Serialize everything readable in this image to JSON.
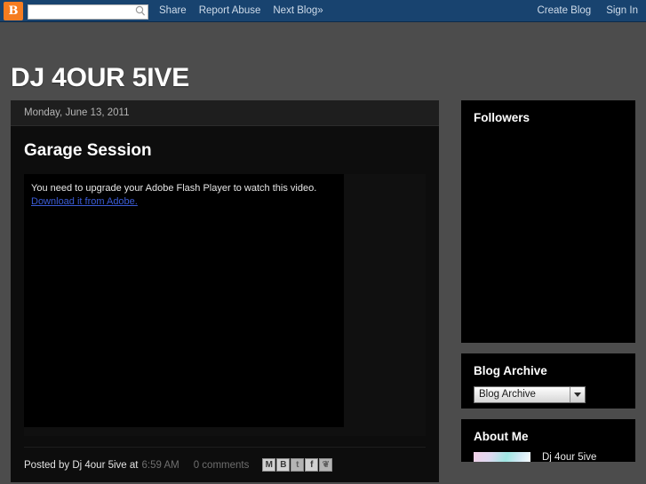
{
  "navbar": {
    "logo_text": "B",
    "logo_icon": "blogger-logo-icon",
    "search_value": "",
    "search_placeholder": "",
    "search_icon": "search-icon",
    "links": [
      {
        "label": "Share"
      },
      {
        "label": "Report Abuse"
      },
      {
        "label": "Next Blog»"
      }
    ],
    "right_links": [
      {
        "label": "Create Blog"
      },
      {
        "label": "Sign In"
      }
    ],
    "background_color": "#18436f",
    "logo_color": "#f57c20"
  },
  "header": {
    "title": "DJ 4OUR 5IVE",
    "background_color": "#4c4c4c",
    "title_color": "#ffffff"
  },
  "main": {
    "date_header": "Monday, June 13, 2011",
    "post": {
      "title": "Garage Session",
      "flash_message": "You need to upgrade your Adobe Flash Player to watch this video.",
      "flash_link_label": "Download it from Adobe.",
      "flash_link_color": "#3b5cd6",
      "footer": {
        "posted_by": "Posted by Dj 4our 5ive at",
        "time": "6:59 AM",
        "comments": "0 comments",
        "share_icons": [
          {
            "name": "email-share-icon",
            "glyph": "M"
          },
          {
            "name": "blogger-share-icon",
            "glyph": "B"
          },
          {
            "name": "twitter-share-icon",
            "glyph": "t"
          },
          {
            "name": "facebook-share-icon",
            "glyph": "f"
          },
          {
            "name": "pinterest-share-icon",
            "glyph": "❦"
          }
        ]
      }
    }
  },
  "sidebar": {
    "followers": {
      "title": "Followers"
    },
    "archive": {
      "title": "Blog Archive",
      "selected_option": "Blog Archive",
      "dropdown_icon": "chevron-down-icon"
    },
    "about": {
      "title": "About Me",
      "profile_name": "Dj 4our 5ive",
      "avatar_icon": "profile-avatar"
    }
  }
}
